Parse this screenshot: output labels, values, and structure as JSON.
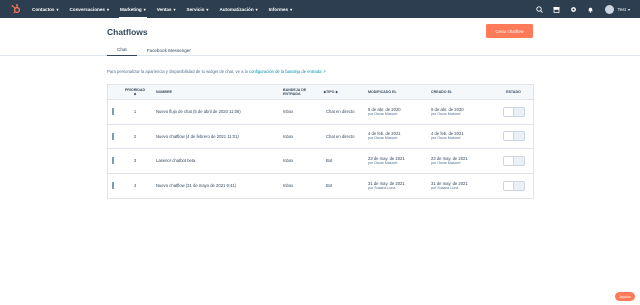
{
  "nav": {
    "logo_icon": "hubspot-sprocket-icon",
    "items": [
      {
        "label": "Contactos",
        "active": false
      },
      {
        "label": "Conversaciones",
        "active": false
      },
      {
        "label": "Marketing",
        "active": true
      },
      {
        "label": "Ventas",
        "active": false
      },
      {
        "label": "Servicio",
        "active": false
      },
      {
        "label": "Automatización",
        "active": false
      },
      {
        "label": "Informes",
        "active": false
      }
    ],
    "right_icons": [
      "search-icon",
      "marketplace-icon",
      "settings-icon",
      "notifications-icon"
    ],
    "user": {
      "name": "Test"
    }
  },
  "page": {
    "title": "Chatflows",
    "primary_button": "Crear chatflow",
    "tabs": [
      {
        "label": "Chat",
        "active": true
      },
      {
        "label": "Facebook Messenger",
        "active": false
      }
    ],
    "info_text": "Para personalizar la apariencia y disponibilidad de tu widget de chat, ve a la ",
    "info_link": "configuración de la bandeja de entrada",
    "info_link_icon": "external-link-icon"
  },
  "table": {
    "headers": {
      "priority": "Prioridad",
      "name": "Nombre",
      "inbox": "Bandeja de entrada",
      "type": "Tipo",
      "modified": "Modificado el",
      "created": "Creado el",
      "state": "Estado"
    },
    "rows": [
      {
        "priority": "1",
        "name": "Nuevo flujo de chat (5 de abril de 2020 11:06)",
        "inbox": "Inbox",
        "type": "Chat en directo",
        "modified_date": "5 de abr. de 2020",
        "modified_by": "por Oscar Mascort",
        "created_date": "5 de abr. de 2020",
        "created_by": "por Oscar Mascort",
        "enabled": false
      },
      {
        "priority": "2",
        "name": "Nuevo chatflow (4 de febrero de 2021 11:01)",
        "inbox": "Inbox",
        "type": "Chat en directo",
        "modified_date": "4 de feb. de 2021",
        "modified_by": "por Oscar Mascort",
        "created_date": "4 de feb. de 2021",
        "created_by": "por Oscar Mascort",
        "enabled": false
      },
      {
        "priority": "3",
        "name": "Lasenor chatbot beta",
        "inbox": "Inbox",
        "type": "Bot",
        "modified_date": "23 de may. de 2021",
        "modified_by": "por Oscar Mascort",
        "created_date": "23 de may. de 2021",
        "created_by": "por Oscar Mascort",
        "enabled": false
      },
      {
        "priority": "4",
        "name": "Nuevo chatflow (31 de mayo de 2021 9:41)",
        "inbox": "Inbox",
        "type": "Bot",
        "modified_date": "31 de may. de 2021",
        "modified_by": "por Susana Luna",
        "created_date": "31 de may. de 2021",
        "created_by": "por Susana Luna",
        "enabled": false
      }
    ]
  },
  "help_button": "Ayuda",
  "colors": {
    "nav_bg": "#2d3e50",
    "accent": "#ff7a59",
    "link": "#0091ae",
    "text": "#33475b"
  }
}
